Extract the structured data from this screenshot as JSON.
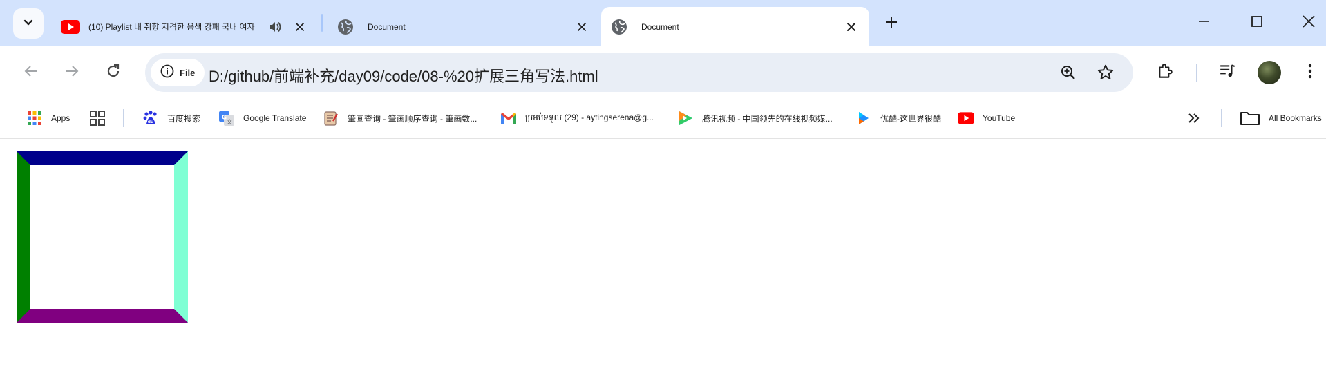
{
  "tabs": [
    {
      "title": "(10) Playlist 내 취향 저격한 음색 강패 국내 여자",
      "favicon": "youtube-icon",
      "audio": true,
      "active": false
    },
    {
      "title": "Document",
      "favicon": "globe-icon",
      "active": false
    },
    {
      "title": "Document",
      "favicon": "globe-icon",
      "active": true
    }
  ],
  "omnibox": {
    "chip_label": "File",
    "url": "D:/github/前端补充/day09/code/08-%20扩展三角写法.html"
  },
  "bookmarks": [
    {
      "label": "Apps",
      "icon": "apps-grid-icon"
    },
    {
      "label": "",
      "icon": "tab-groups-icon"
    },
    {
      "label": "百度搜索",
      "icon": "baidu-icon"
    },
    {
      "label": "Google Translate",
      "icon": "google-translate-icon"
    },
    {
      "label": "筆画查询 - 筆画顺序查询 - 筆画数...",
      "icon": "notepad-icon"
    },
    {
      "label": "ប្រអប់ទទួល (29) - aytingserena@g...",
      "icon": "gmail-icon"
    },
    {
      "label": "腾讯视频 - 中国领先的在线视频媒...",
      "icon": "tencent-video-icon"
    },
    {
      "label": "优酷-这世界很酷",
      "icon": "youku-icon"
    },
    {
      "label": "YouTube",
      "icon": "youtube-icon"
    }
  ],
  "all_bookmarks_label": "All Bookmarks",
  "demo_box": {
    "border_top_color": "#00008b",
    "border_right_color": "#7fffd4",
    "border_bottom_color": "#800080",
    "border_left_color": "#008000",
    "fill_color": "#ffffff"
  },
  "colors": {
    "tabstrip_bg": "#d3e3fd",
    "omnibox_bg": "#e9eef6",
    "youtube_red": "#ff0000"
  }
}
